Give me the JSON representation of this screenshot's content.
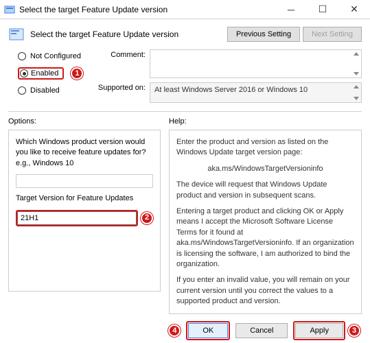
{
  "window": {
    "title": "Select the target Feature Update version"
  },
  "header": {
    "title": "Select the target Feature Update version",
    "previous": "Previous Setting",
    "next": "Next Setting"
  },
  "states": {
    "not_configured": "Not Configured",
    "enabled": "Enabled",
    "disabled": "Disabled"
  },
  "labels": {
    "comment": "Comment:",
    "supported": "Supported on:",
    "options": "Options:",
    "help": "Help:"
  },
  "supported_text": "At least Windows Server 2016 or Windows 10",
  "options": {
    "product_prompt": "Which Windows product version would you like to receive feature updates for? e.g., Windows 10",
    "target_label": "Target Version for Feature Updates",
    "target_value": "21H1"
  },
  "help": {
    "p1": "Enter the product and version as listed on the Windows Update target version page:",
    "p2": "aka.ms/WindowsTargetVersioninfo",
    "p3": "The device will request that Windows Update product and version in subsequent scans.",
    "p4": "Entering a target product and clicking OK or Apply means I accept the Microsoft Software License Terms for it found at aka.ms/WindowsTargetVersioninfo. If an organization is licensing the software, I am authorized to bind the organization.",
    "p5": "If you enter an invalid value, you will remain on your current version until you correct the values to a supported product and version."
  },
  "buttons": {
    "ok": "OK",
    "cancel": "Cancel",
    "apply": "Apply"
  },
  "badges": {
    "b1": "1",
    "b2": "2",
    "b3": "3",
    "b4": "4"
  }
}
